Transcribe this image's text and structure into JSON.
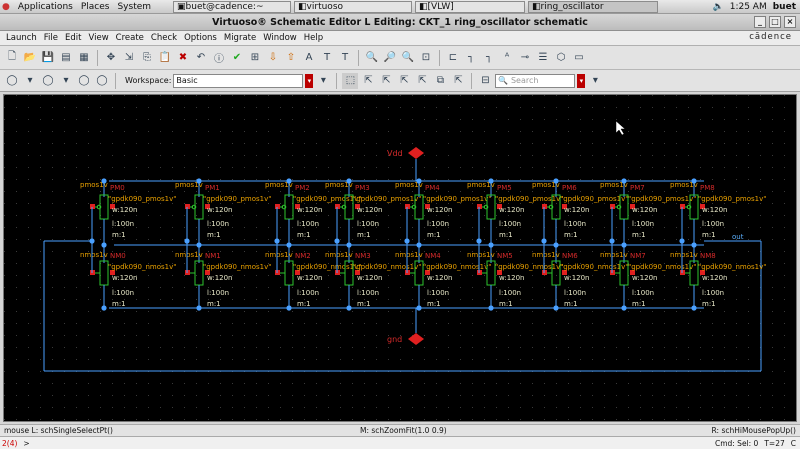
{
  "topbar": {
    "menus": [
      "Applications",
      "Places",
      "System"
    ],
    "tasks": [
      "buet@cadence:~",
      "virtuoso",
      "[VLW]",
      "ring_oscillator"
    ],
    "clock": "1:25 AM",
    "user": "buet"
  },
  "window": {
    "title": "Virtuoso® Schematic Editor L Editing: CKT_1 ring_oscillator schematic"
  },
  "menubar": {
    "items": [
      "Launch",
      "File",
      "Edit",
      "View",
      "Create",
      "Check",
      "Options",
      "Migrate",
      "Window",
      "Help"
    ],
    "brand": "cādence"
  },
  "toolbar2": {
    "workspace_label": "Workspace:",
    "workspace_value": "Basic",
    "search_placeholder": "Search"
  },
  "schematic": {
    "pins": {
      "vdd": "Vdd",
      "gnd": "gnd",
      "out": "out"
    },
    "pmos_names": [
      "PM0",
      "PM1",
      "PM2",
      "PM3",
      "PM4",
      "PM5",
      "PM6",
      "PM7",
      "PM8"
    ],
    "nmos_names": [
      "NM0",
      "NM1",
      "NM2",
      "NM3",
      "NM4",
      "NM5",
      "NM6",
      "NM7",
      "NM8"
    ],
    "pmos_model": "\"gpdk090_pmos1v\"",
    "nmos_model": "\"gpdk090_nmos1v\"",
    "pmos_type": "pmos1v",
    "nmos_type": "nmos1v",
    "width": "w:120n",
    "length": "l:100n",
    "mult": "m:1"
  },
  "status": {
    "left": "mouse L: schSingleSelectPt()",
    "mid": "M: schZoomFit(1.0 0.9)",
    "right": "R: schHiMousePopUp()"
  },
  "cmdbar": {
    "line": "2(4)",
    "prompt": ">",
    "cmd": "Cmd: Sel: 0",
    "t": "T=27",
    "c": "C"
  }
}
